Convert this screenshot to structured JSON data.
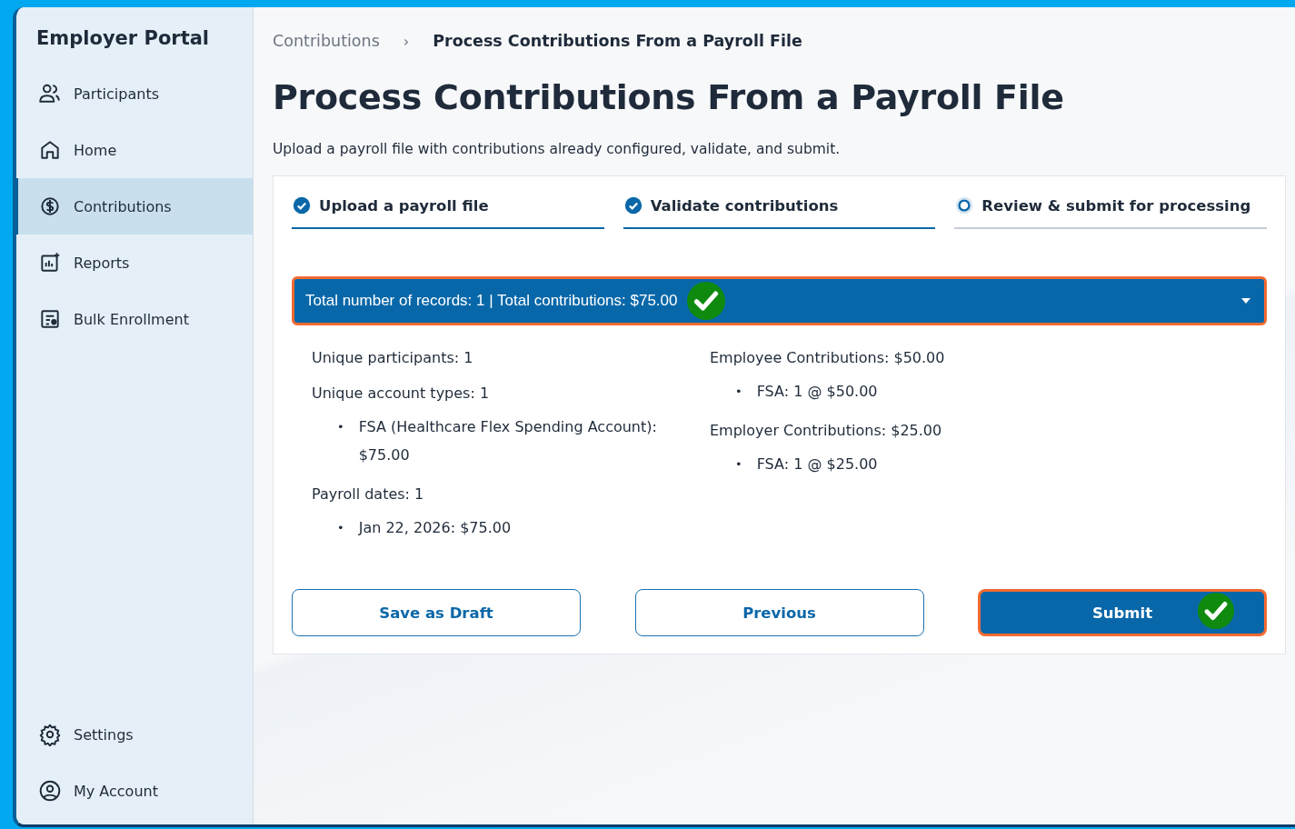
{
  "sidebar": {
    "title": "Employer Portal",
    "items": [
      {
        "label": "Participants",
        "selected": false
      },
      {
        "label": "Home",
        "selected": false
      },
      {
        "label": "Contributions",
        "selected": true
      },
      {
        "label": "Reports",
        "selected": false
      },
      {
        "label": "Bulk Enrollment",
        "selected": false
      }
    ],
    "footer_items": [
      {
        "label": "Settings",
        "selected": false
      },
      {
        "label": "My Account",
        "selected": false
      }
    ]
  },
  "breadcrumb": [
    {
      "label": "Contributions",
      "current": false
    },
    {
      "label": "Process Contributions From a Payroll File",
      "current": true
    }
  ],
  "breadcrumb_separator": "›",
  "page_title": "Process Contributions From a Payroll File",
  "description": "Upload a payroll file with contributions already configured, validate, and submit.",
  "steps": [
    {
      "label": "Upload a payroll file",
      "completed": true
    },
    {
      "label": "Validate contributions",
      "completed": true
    },
    {
      "label": "Review & submit for processing",
      "completed": false
    }
  ],
  "summary": {
    "text": "Total number of records: 1 | Total contributions: $75.00",
    "expanded": true,
    "highlighted": true
  },
  "details": {
    "bullet_marker": "•",
    "left": [
      {
        "label": "Unique participants: 1"
      },
      {
        "label": "Unique account types: 1",
        "bullets": [
          "FSA (Healthcare Flex Spending Account): $75.00"
        ]
      },
      {
        "label": "Payroll dates: 1",
        "bullets": [
          "Jan 22, 2026: $75.00"
        ]
      }
    ],
    "right": [
      {
        "label": "Employee Contributions: $50.00",
        "bullets": [
          "FSA: 1 @ $50.00"
        ]
      },
      {
        "label": "Employer Contributions: $25.00",
        "bullets": [
          "FSA: 1 @ $25.00"
        ]
      }
    ]
  },
  "buttons": [
    {
      "label": "Save as Draft",
      "kind": "outline",
      "highlighted": false
    },
    {
      "label": "Previous",
      "kind": "outline",
      "highlighted": false
    },
    {
      "label": "Submit",
      "kind": "primary",
      "highlighted": true
    }
  ]
}
